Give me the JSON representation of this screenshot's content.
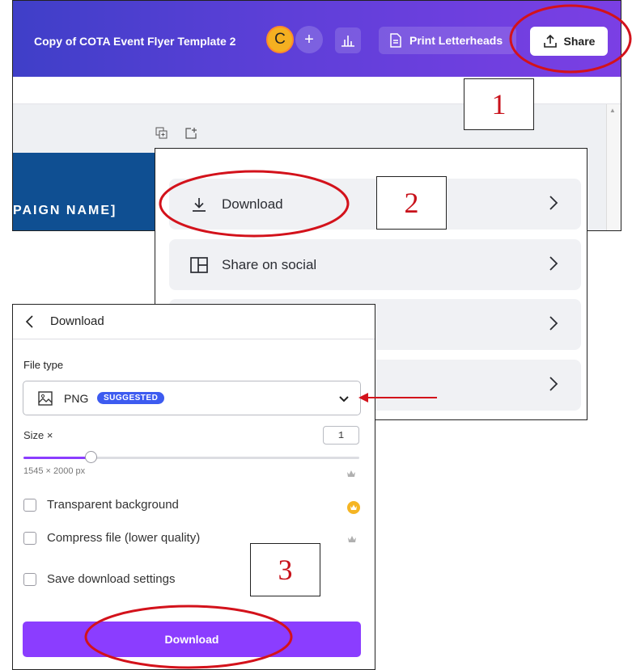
{
  "editor": {
    "doc_title": "Copy of COTA Event Flyer Template 2",
    "avatar_initial": "C",
    "add_symbol": "+",
    "print_label": "Print Letterheads",
    "share_label": "Share",
    "banner_text": "PAIGN NAME]"
  },
  "share_menu": {
    "items": [
      {
        "label": "Download",
        "icon": "download-icon"
      },
      {
        "label": "Share on social",
        "icon": "social-layout-icon"
      },
      {
        "label": "",
        "icon": ""
      },
      {
        "label": "",
        "icon": ""
      }
    ]
  },
  "download_panel": {
    "title": "Download",
    "file_type_label": "File type",
    "file_type_value": "PNG",
    "suggested_badge": "SUGGESTED",
    "size_label": "Size ×",
    "size_value": "1",
    "size_slider_fraction": 0.2,
    "dimensions": "1545 × 2000 px",
    "options": [
      {
        "label": "Transparent background",
        "checked": false,
        "badge": "gold-crown-icon"
      },
      {
        "label": "Compress file (lower quality)",
        "checked": false,
        "badge": "crown-icon"
      },
      {
        "label": "Save download settings",
        "checked": false,
        "badge": ""
      }
    ],
    "download_button": "Download"
  },
  "annotations": {
    "step_labels": [
      "1",
      "2",
      "3"
    ],
    "color": "#d3121b"
  },
  "colors": {
    "topbar_gradient": [
      "#3f3fc8",
      "#7b3fe4"
    ],
    "accent_purple": "#8b3dff",
    "suggested_blue": "#3d5bf0",
    "avatar_yellow": "#f4b021",
    "banner_blue": "#0f4f92"
  }
}
